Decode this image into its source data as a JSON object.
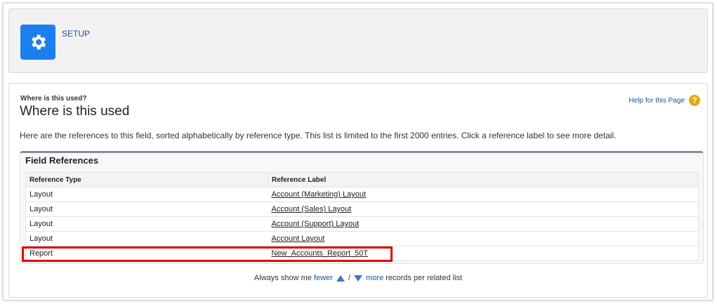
{
  "header": {
    "setup_label": "SETUP",
    "icon": "gear-icon",
    "tile_color": "#1b7ff0"
  },
  "page": {
    "eyebrow": "Where is this used?",
    "title": "Where is this used",
    "help_link": "Help for this Page",
    "help_icon_glyph": "?",
    "description": "Here are the references to this field, sorted alphabetically by reference type. This list is limited to the first 2000 entries. Click a reference label to see more detail."
  },
  "field_references": {
    "title": "Field References",
    "columns": [
      "Reference Type",
      "Reference Label"
    ],
    "rows": [
      {
        "type": "Layout",
        "label": "Account (Marketing) Layout"
      },
      {
        "type": "Layout",
        "label": "Account (Sales) Layout"
      },
      {
        "type": "Layout",
        "label": "Account (Support) Layout"
      },
      {
        "type": "Layout",
        "label": "Account Layout"
      },
      {
        "type": "Report",
        "label": "New_Accounts_Report_50T"
      }
    ],
    "highlight_color": "#e30000"
  },
  "pager": {
    "prefix": "Always show me",
    "fewer": "fewer",
    "separator": "/",
    "more": "more",
    "suffix": "records per related list"
  }
}
